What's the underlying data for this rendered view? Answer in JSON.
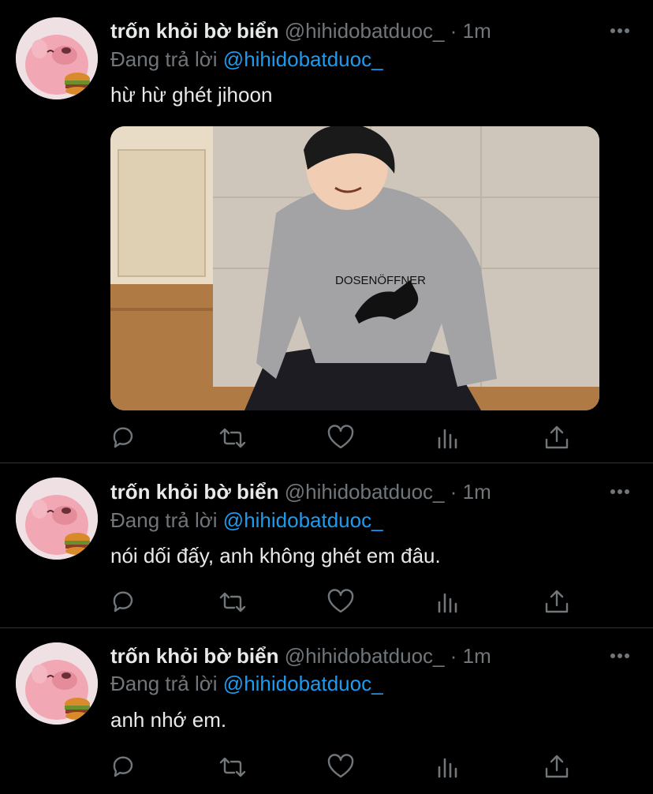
{
  "tweets": [
    {
      "name": "trốn khỏi bờ biển",
      "handle": "@hihidobatduoc_",
      "separator": "·",
      "time": "1m",
      "reply_prefix": "Đang trả lời",
      "reply_to": "@hihidobatduoc_",
      "text": "hừ hừ ghét jihoon",
      "media": {
        "sweatshirt_text": "DOSENÖFFNER"
      }
    },
    {
      "name": "trốn khỏi bờ biển",
      "handle": "@hihidobatduoc_",
      "separator": "·",
      "time": "1m",
      "reply_prefix": "Đang trả lời",
      "reply_to": "@hihidobatduoc_",
      "text": "nói dối đấy, anh không ghét em đâu."
    },
    {
      "name": "trốn khỏi bờ biển",
      "handle": "@hihidobatduoc_",
      "separator": "·",
      "time": "1m",
      "reply_prefix": "Đang trả lời",
      "reply_to": "@hihidobatduoc_",
      "text": "anh nhớ em."
    }
  ],
  "action_icons": [
    "reply-icon",
    "retweet-icon",
    "like-icon",
    "analytics-icon",
    "share-icon"
  ],
  "colors": {
    "background": "#000000",
    "text": "#e7e9ea",
    "muted": "#71767b",
    "link": "#1d9bf0",
    "divider": "#2f3336"
  }
}
